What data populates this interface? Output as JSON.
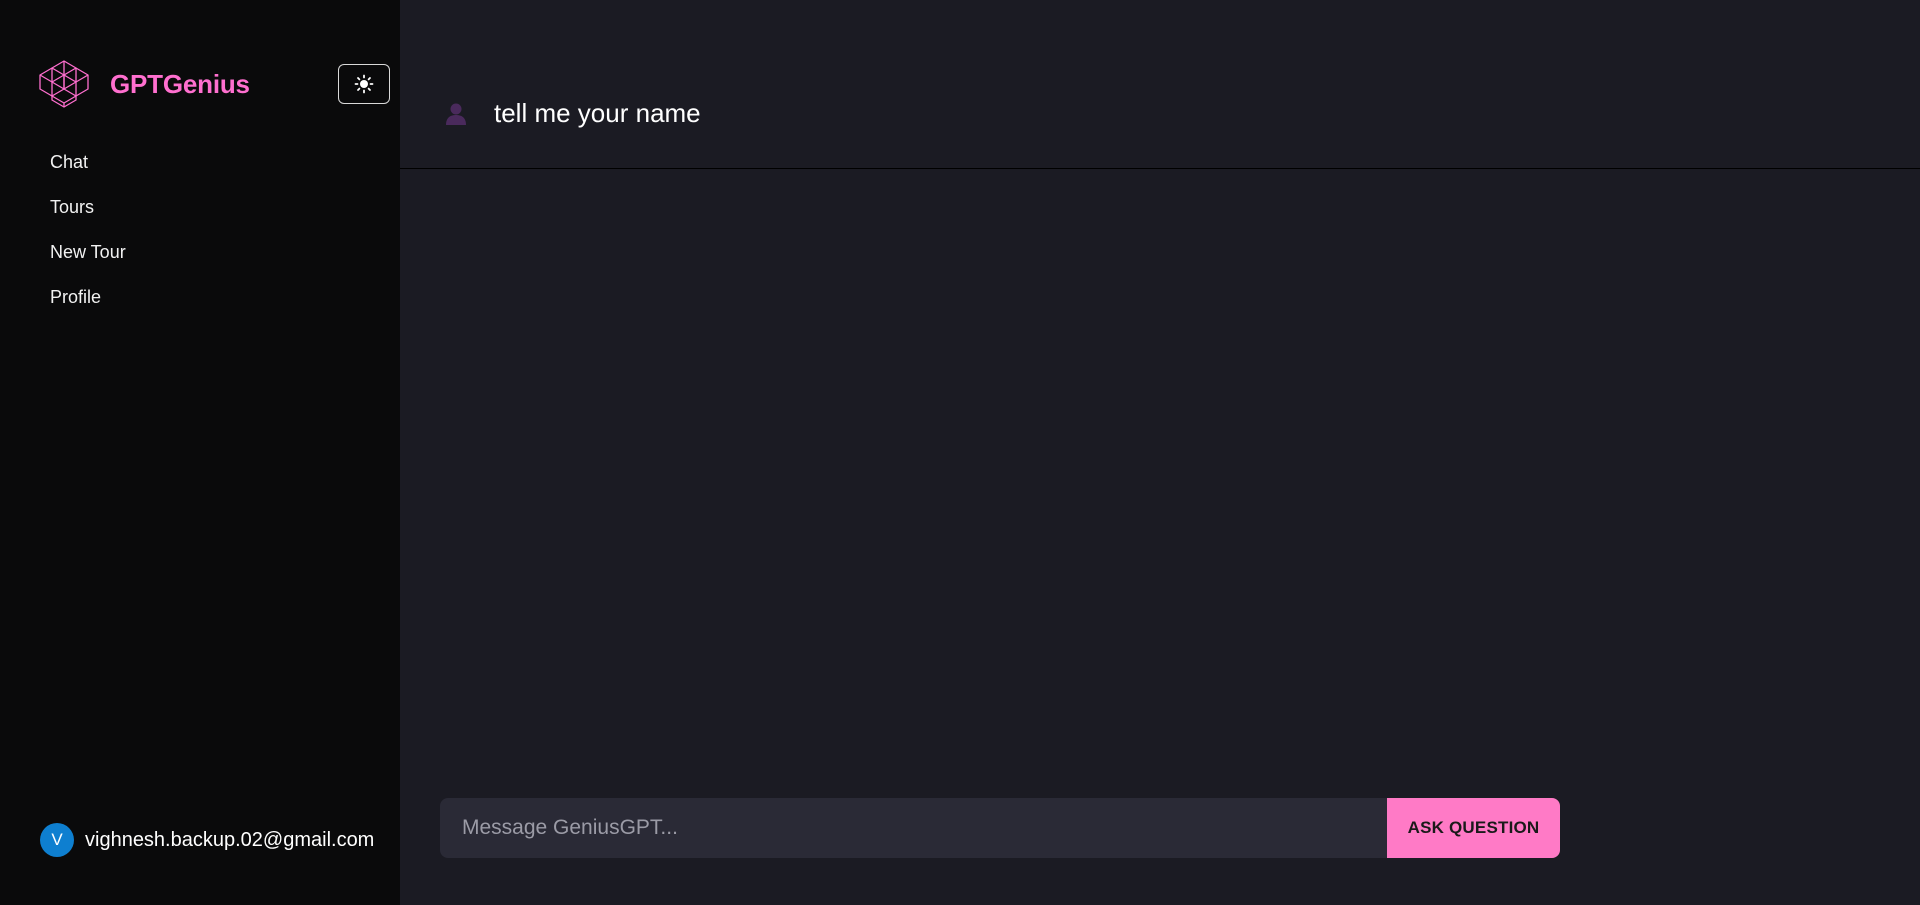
{
  "sidebar": {
    "brand_name": "GPTGenius",
    "theme_toggle_icon": "sun-icon",
    "nav": [
      {
        "label": "Chat"
      },
      {
        "label": "Tours"
      },
      {
        "label": "New Tour"
      },
      {
        "label": "Profile"
      }
    ],
    "user": {
      "avatar_initial": "V",
      "email": "vighnesh.backup.02@gmail.com"
    }
  },
  "chat": {
    "messages": [
      {
        "role": "user",
        "icon": "user-icon",
        "text": "tell me your name"
      }
    ]
  },
  "composer": {
    "placeholder": "Message GeniusGPT...",
    "value": "",
    "button_label": "ASK QUESTION"
  },
  "colors": {
    "brand": "#ff6fcf",
    "accent_button": "#ff7ac6",
    "sidebar_bg": "#0a0a0b",
    "main_bg": "#1b1b23",
    "input_bg": "#2a2a36",
    "avatar_bg": "#0e7fd0"
  }
}
